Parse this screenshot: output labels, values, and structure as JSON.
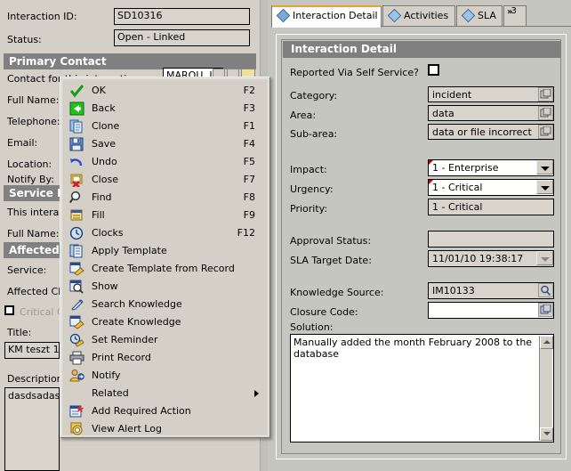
{
  "left_panel": {
    "fields": [
      {
        "label": "Interaction ID:",
        "value": "SD10316"
      },
      {
        "label": "Status:",
        "value": "Open - Linked"
      }
    ],
    "primary_contact_header": "Primary Contact",
    "contact_label": "Contact for this interaction:",
    "contact_value": "MAROU, JIM",
    "full_name_label": "Full Name:",
    "telephone_label": "Telephone:",
    "email_label": "Email:",
    "location_label": "Location:",
    "notify_by_label": "Notify By:",
    "service_recipient_header": "Service Re",
    "this_interaction_label": "This interactio",
    "full_name_label2": "Full Name:",
    "affected_items_header": "Affected It",
    "service_label": "Service:",
    "affected_ci_label": "Affected CI:",
    "critical_ci_label": "Critical CI",
    "title_label": "Title:",
    "title_value": "KM teszt 1",
    "description_label": "Description:",
    "description_value": "dasdsadasds"
  },
  "tabs": [
    {
      "label": "Interaction Detail",
      "active": true
    },
    {
      "label": "Activities",
      "active": false
    },
    {
      "label": "SLA",
      "active": false
    }
  ],
  "tab_overflow": {
    "chevron": "»",
    "count": "3"
  },
  "detail": {
    "title": "Interaction Detail",
    "self_service_label": "Reported Via Self Service?",
    "self_service_checked": false,
    "rows": [
      {
        "label": "Category:",
        "value": "incident",
        "control": "lookup"
      },
      {
        "label": "Area:",
        "value": "data",
        "control": "lookup"
      },
      {
        "label": "Sub-area:",
        "value": "data or file incorrect",
        "control": "lookup"
      },
      {
        "label": "Impact:",
        "value": "1 - Enterprise",
        "control": "combo",
        "required": true
      },
      {
        "label": "Urgency:",
        "value": "1 - Critical",
        "control": "combo",
        "required": true
      },
      {
        "label": "Priority:",
        "value": "1 - Critical",
        "control": "readonly"
      },
      {
        "label": "Approval Status:",
        "value": "",
        "control": "readonly"
      },
      {
        "label": "SLA Target Date:",
        "value": "11/01/10 19:38:17",
        "control": "combo-dim"
      },
      {
        "label": "Knowledge Source:",
        "value": "IM10133",
        "control": "search"
      },
      {
        "label": "Closure Code:",
        "value": "",
        "control": "lookup-white"
      }
    ],
    "solution_label": "Solution:",
    "solution_value": "Manually added the month February 2008 to the database"
  },
  "context_menu": {
    "items": [
      {
        "label": "OK",
        "accel": "F2",
        "icon": "check-icon"
      },
      {
        "label": "Back",
        "accel": "F3",
        "icon": "back-arrow-icon"
      },
      {
        "label": "Clone",
        "accel": "F1",
        "icon": "copy-icon"
      },
      {
        "label": "Save",
        "accel": "F4",
        "icon": "floppy-disk-icon"
      },
      {
        "label": "Undo",
        "accel": "F5",
        "icon": "undo-icon"
      },
      {
        "label": "Close",
        "accel": "F7",
        "icon": "close-folder-icon"
      },
      {
        "label": "Find",
        "accel": "F8",
        "icon": "magnifier-icon"
      },
      {
        "label": "Fill",
        "accel": "F9",
        "icon": "fill-list-icon"
      },
      {
        "label": "Clocks",
        "accel": "F12",
        "icon": "clock-icon"
      },
      {
        "label": "Apply Template",
        "accel": "",
        "icon": "template-icon"
      },
      {
        "label": "Create Template from Record",
        "accel": "",
        "icon": "create-template-icon"
      },
      {
        "label": "Show",
        "accel": "",
        "icon": "show-record-icon"
      },
      {
        "label": "Search Knowledge",
        "accel": "",
        "icon": "search-knowledge-icon"
      },
      {
        "label": "Create Knowledge",
        "accel": "",
        "icon": "create-knowledge-icon"
      },
      {
        "label": "Set Reminder",
        "accel": "",
        "icon": "reminder-clock-icon"
      },
      {
        "label": "Print Record",
        "accel": "",
        "icon": "printer-icon"
      },
      {
        "label": "Notify",
        "accel": "",
        "icon": "notify-user-icon"
      },
      {
        "label": "Related",
        "accel": "",
        "icon": "none",
        "submenu": true
      },
      {
        "label": "Add Required Action",
        "accel": "",
        "icon": "add-action-icon"
      },
      {
        "label": "View Alert Log",
        "accel": "",
        "icon": "alert-log-icon"
      }
    ]
  },
  "colors": {
    "window_bg": "#d4d0c8",
    "section_header": "#808080",
    "field_bg": "#d8d4cc",
    "accent_tab": "#f0a030",
    "required_marker": "#c00000"
  }
}
